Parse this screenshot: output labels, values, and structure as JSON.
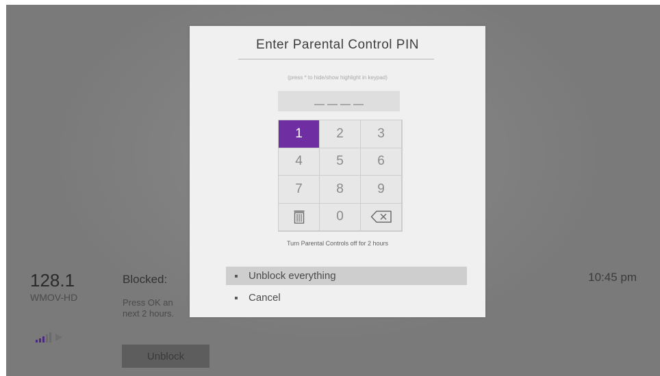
{
  "channel": {
    "number": "128.1",
    "name": "WMOV-HD"
  },
  "program": {
    "status": "Blocked:",
    "description": "Press OK an\nnext 2 hours."
  },
  "unblock_button": "Unblock",
  "clock": "10:45 pm",
  "signal_icon": "signal-strength-icon",
  "colors": {
    "accent": "#6f2fa3",
    "dialog_bg": "#f0f0f0",
    "backdrop": "#7a7a7a"
  },
  "dialog": {
    "title": "Enter Parental Control PIN",
    "hint": "(press * to hide/show highlight in keypad)",
    "pin_length": 4,
    "keypad": {
      "selected_key": "1",
      "keys": [
        {
          "label": "1"
        },
        {
          "label": "2"
        },
        {
          "label": "3"
        },
        {
          "label": "4"
        },
        {
          "label": "5"
        },
        {
          "label": "6"
        },
        {
          "label": "7"
        },
        {
          "label": "8"
        },
        {
          "label": "9"
        },
        {
          "icon": "trash-icon"
        },
        {
          "label": "0"
        },
        {
          "icon": "backspace-icon"
        }
      ]
    },
    "note": "Turn Parental Controls off for 2 hours",
    "options": [
      {
        "label": "Unblock everything",
        "highlighted": true
      },
      {
        "label": "Cancel",
        "highlighted": false
      }
    ]
  }
}
